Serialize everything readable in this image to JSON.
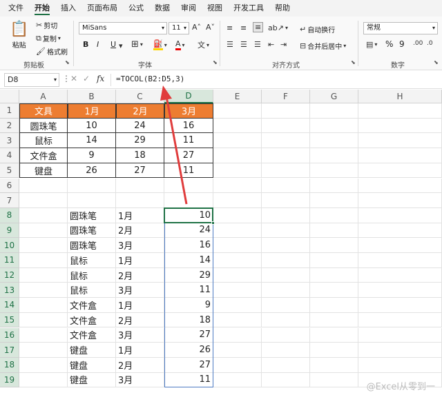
{
  "tabs": [
    "文件",
    "开始",
    "插入",
    "页面布局",
    "公式",
    "数据",
    "审阅",
    "视图",
    "开发工具",
    "帮助"
  ],
  "active_tab": "开始",
  "ribbon": {
    "paste": "粘贴",
    "cut": "剪切",
    "copy": "复制",
    "format_painter": "格式刷",
    "clipboard_label": "剪贴板",
    "font_name": "MiSans",
    "font_size": "11",
    "font_label": "字体",
    "bold": "B",
    "italic": "I",
    "underline": "U",
    "wrap_text": "自动换行",
    "merge_center": "合并后居中",
    "align_label": "对齐方式",
    "number_format": "常规",
    "number_label": "数字",
    "percent": "%",
    "comma": "9"
  },
  "formula_bar": {
    "name_box": "D8",
    "fx": "fx",
    "formula": "=TOCOL(B2:D5,3)"
  },
  "columns": [
    "A",
    "B",
    "C",
    "D",
    "E",
    "F",
    "G",
    "H"
  ],
  "rows": [
    "1",
    "2",
    "3",
    "4",
    "5",
    "6",
    "7",
    "8",
    "9",
    "10",
    "11",
    "12",
    "13",
    "14",
    "15",
    "16",
    "17",
    "18",
    "19"
  ],
  "table": {
    "header": [
      "文具",
      "1月",
      "2月",
      "3月"
    ],
    "body": [
      [
        "圆珠笔",
        "10",
        "24",
        "16"
      ],
      [
        "鼠标",
        "14",
        "29",
        "11"
      ],
      [
        "文件盒",
        "9",
        "18",
        "27"
      ],
      [
        "键盘",
        "26",
        "27",
        "11"
      ]
    ]
  },
  "result": [
    [
      "圆珠笔",
      "1月",
      "10"
    ],
    [
      "圆珠笔",
      "2月",
      "24"
    ],
    [
      "圆珠笔",
      "3月",
      "16"
    ],
    [
      "鼠标",
      "1月",
      "14"
    ],
    [
      "鼠标",
      "2月",
      "29"
    ],
    [
      "鼠标",
      "3月",
      "11"
    ],
    [
      "文件盒",
      "1月",
      "9"
    ],
    [
      "文件盒",
      "2月",
      "18"
    ],
    [
      "文件盒",
      "3月",
      "27"
    ],
    [
      "键盘",
      "1月",
      "26"
    ],
    [
      "键盘",
      "2月",
      "27"
    ],
    [
      "键盘",
      "3月",
      "11"
    ]
  ],
  "watermark": "@Excel从零到一",
  "colors": {
    "header_fill": "#ed7d31",
    "selection": "#1e7145",
    "arrow": "#e03c3c"
  }
}
